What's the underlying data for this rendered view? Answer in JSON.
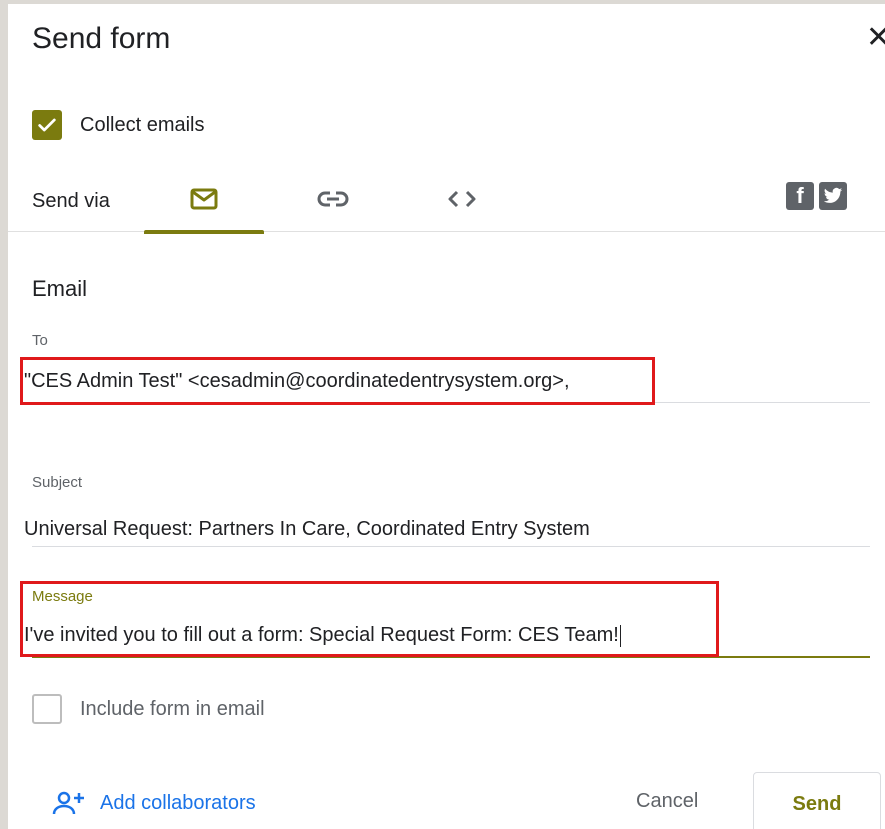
{
  "dialog": {
    "title": "Send form",
    "close_icon": "close-icon"
  },
  "collect_emails": {
    "label": "Collect emails",
    "checked": true
  },
  "send_via": {
    "label": "Send via",
    "tabs": [
      {
        "icon": "email-icon",
        "active": true
      },
      {
        "icon": "link-icon",
        "active": false
      },
      {
        "icon": "embed-code-icon",
        "active": false
      }
    ],
    "social": [
      {
        "icon": "facebook-icon",
        "glyph": "f"
      },
      {
        "icon": "twitter-icon",
        "glyph": "t"
      }
    ]
  },
  "email": {
    "section_title": "Email",
    "to": {
      "label": "To",
      "value": "\"CES Admin Test\" <cesadmin@coordinatedentrysystem.org>,"
    },
    "subject": {
      "label": "Subject",
      "value": "Universal Request: Partners In Care, Coordinated Entry System"
    },
    "message": {
      "label": "Message",
      "value": "I've invited you to fill out a form: Special Request Form: CES Team!"
    },
    "include_form": {
      "label": "Include form in email",
      "checked": false
    }
  },
  "footer": {
    "add_collaborators": "Add collaborators",
    "cancel": "Cancel",
    "send": "Send"
  },
  "colors": {
    "accent": "#7b7b0f",
    "link": "#1a73e8",
    "highlight": "#e0191b"
  }
}
